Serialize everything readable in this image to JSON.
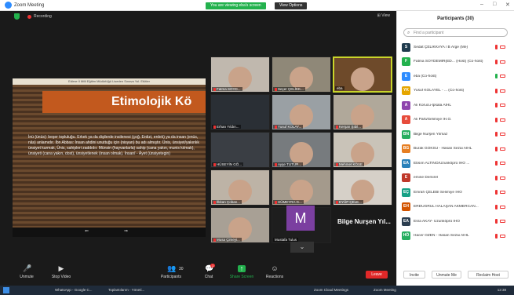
{
  "window": {
    "title": "Zoom Meeting"
  },
  "banner": {
    "text": "You are viewing eba's screen",
    "view_options": "View Options"
  },
  "stage": {
    "recording": "Recording",
    "view_label": "View"
  },
  "share": {
    "header": "Edirne İl Milli Eğitim Müdürlüğü Liseden Sınava Yol. Etütler",
    "title": "Etimolojik Kö",
    "body": "İnü (ünüs): beşer topluluğu. Erkek ya da dişilerde insilenesi (çoğ. Erdizi, erdek) ya da insan (enüs, nâs) anlamıdır. İbn Abbas: İnsan ahdini unuttuğu için (nisyan) bu adı almıştır. Ünis, ünsiyet/yakınlık ünsiyet kurmak, Ünis, sahipleri zaddıdır. Münsin (hayvanlarla) sahip (cana yakın, munis kılmak), ünsiyeti (cana yakın, dost), ünsiyetlenek (insan olmak). İnsanî - Âyet (ünsiyetegin)",
    "nav_prev": "⇐",
    "nav_next": "⇒"
  },
  "tiles": [
    {
      "name": "Fatma SOYD..."
    },
    {
      "name": "Seçer ÇELİKK..."
    },
    {
      "name": "eba"
    },
    {
      "name": "Erhan Yıldırı..."
    },
    {
      "name": "Yusuf KOLAY..."
    },
    {
      "name": "Kerşan Şıbil..."
    },
    {
      "name": "HÜSEYİN GÖ..."
    },
    {
      "name": "Ayşe TUTUR..."
    },
    {
      "name": "Mehmet KÖSE"
    },
    {
      "name": "İlkkan Çoban..."
    },
    {
      "name": "HÜMEYRA G..."
    },
    {
      "name": "EYÜP ÇELE..."
    },
    {
      "name": "Musa Çimeyi..."
    },
    {
      "name": "Mustafa Tulus"
    }
  ],
  "big_name": "Bilge Nurşen Yıl...",
  "m_letter": "M",
  "toolbar": {
    "unmute": "Unmute",
    "stop_video": "Stop Video",
    "participants": "Participants",
    "participants_count": "30",
    "chat": "Chat",
    "chat_badge": "1",
    "share_screen": "Share Screen",
    "reactions": "Reactions",
    "leave": "Leave"
  },
  "panel": {
    "title": "Participants (30)",
    "search_placeholder": "Find a participant",
    "people": [
      {
        "initials": "S",
        "color": "#1f3b4d",
        "name": "Sedat ÇELİKKAYA / B Arge (Me)"
      },
      {
        "initials": "F",
        "color": "#23b14d",
        "name": "Fatma SOYDEMİR(ED... (Host) (Co-host)"
      },
      {
        "initials": "E",
        "color": "#2d8cff",
        "name": "eba (Co-host)"
      },
      {
        "initials": "YK",
        "color": "#e5a600",
        "name": "Yusuf KOLAYEL - ... (Co-host)"
      },
      {
        "initials": "A",
        "color": "#8e44ad",
        "name": "Ali Korucu-İpsala AİHL"
      },
      {
        "initials": "A",
        "color": "#e74c3c",
        "name": "Ali Parti/Selimiye İH.O."
      },
      {
        "initials": "BN",
        "color": "#27ae60",
        "name": "Bilge Nurşen Yılmaz"
      },
      {
        "initials": "BG",
        "color": "#e67e22",
        "name": "Burak GÖKSU - Hasan Sezai AİHL"
      },
      {
        "initials": "EA",
        "color": "#2980b9",
        "name": "Ebsım ALTINO/Uzunköprü İHO ..."
      },
      {
        "initials": "E",
        "color": "#c0392b",
        "name": "emine Demirel"
      },
      {
        "initials": "EÇ",
        "color": "#16a085",
        "name": "Emrah ÇELEBİ Selimiye İHO"
      },
      {
        "initials": "EH",
        "color": "#d35400",
        "name": "ERDUĞRUL HALAŞAN AKMERCAN..."
      },
      {
        "initials": "EA",
        "color": "#2c3e50",
        "name": "Esra AKAY- Uzunköprü İHO"
      },
      {
        "initials": "HÖ",
        "color": "#27ae60",
        "name": "Hacer ÖZEN - Hasan Sezai AİHL"
      }
    ],
    "invite": "Invite",
    "unmute_me": "Unmute Me",
    "reclaim_host": "Reclaim Host"
  },
  "taskbar": {
    "items": [
      "WhatsApp - Google C...",
      "Toplantılarım - Yöneti...",
      "Zoom Cloud Meetings",
      "Zoom Meeting"
    ],
    "tray": "12:38"
  }
}
